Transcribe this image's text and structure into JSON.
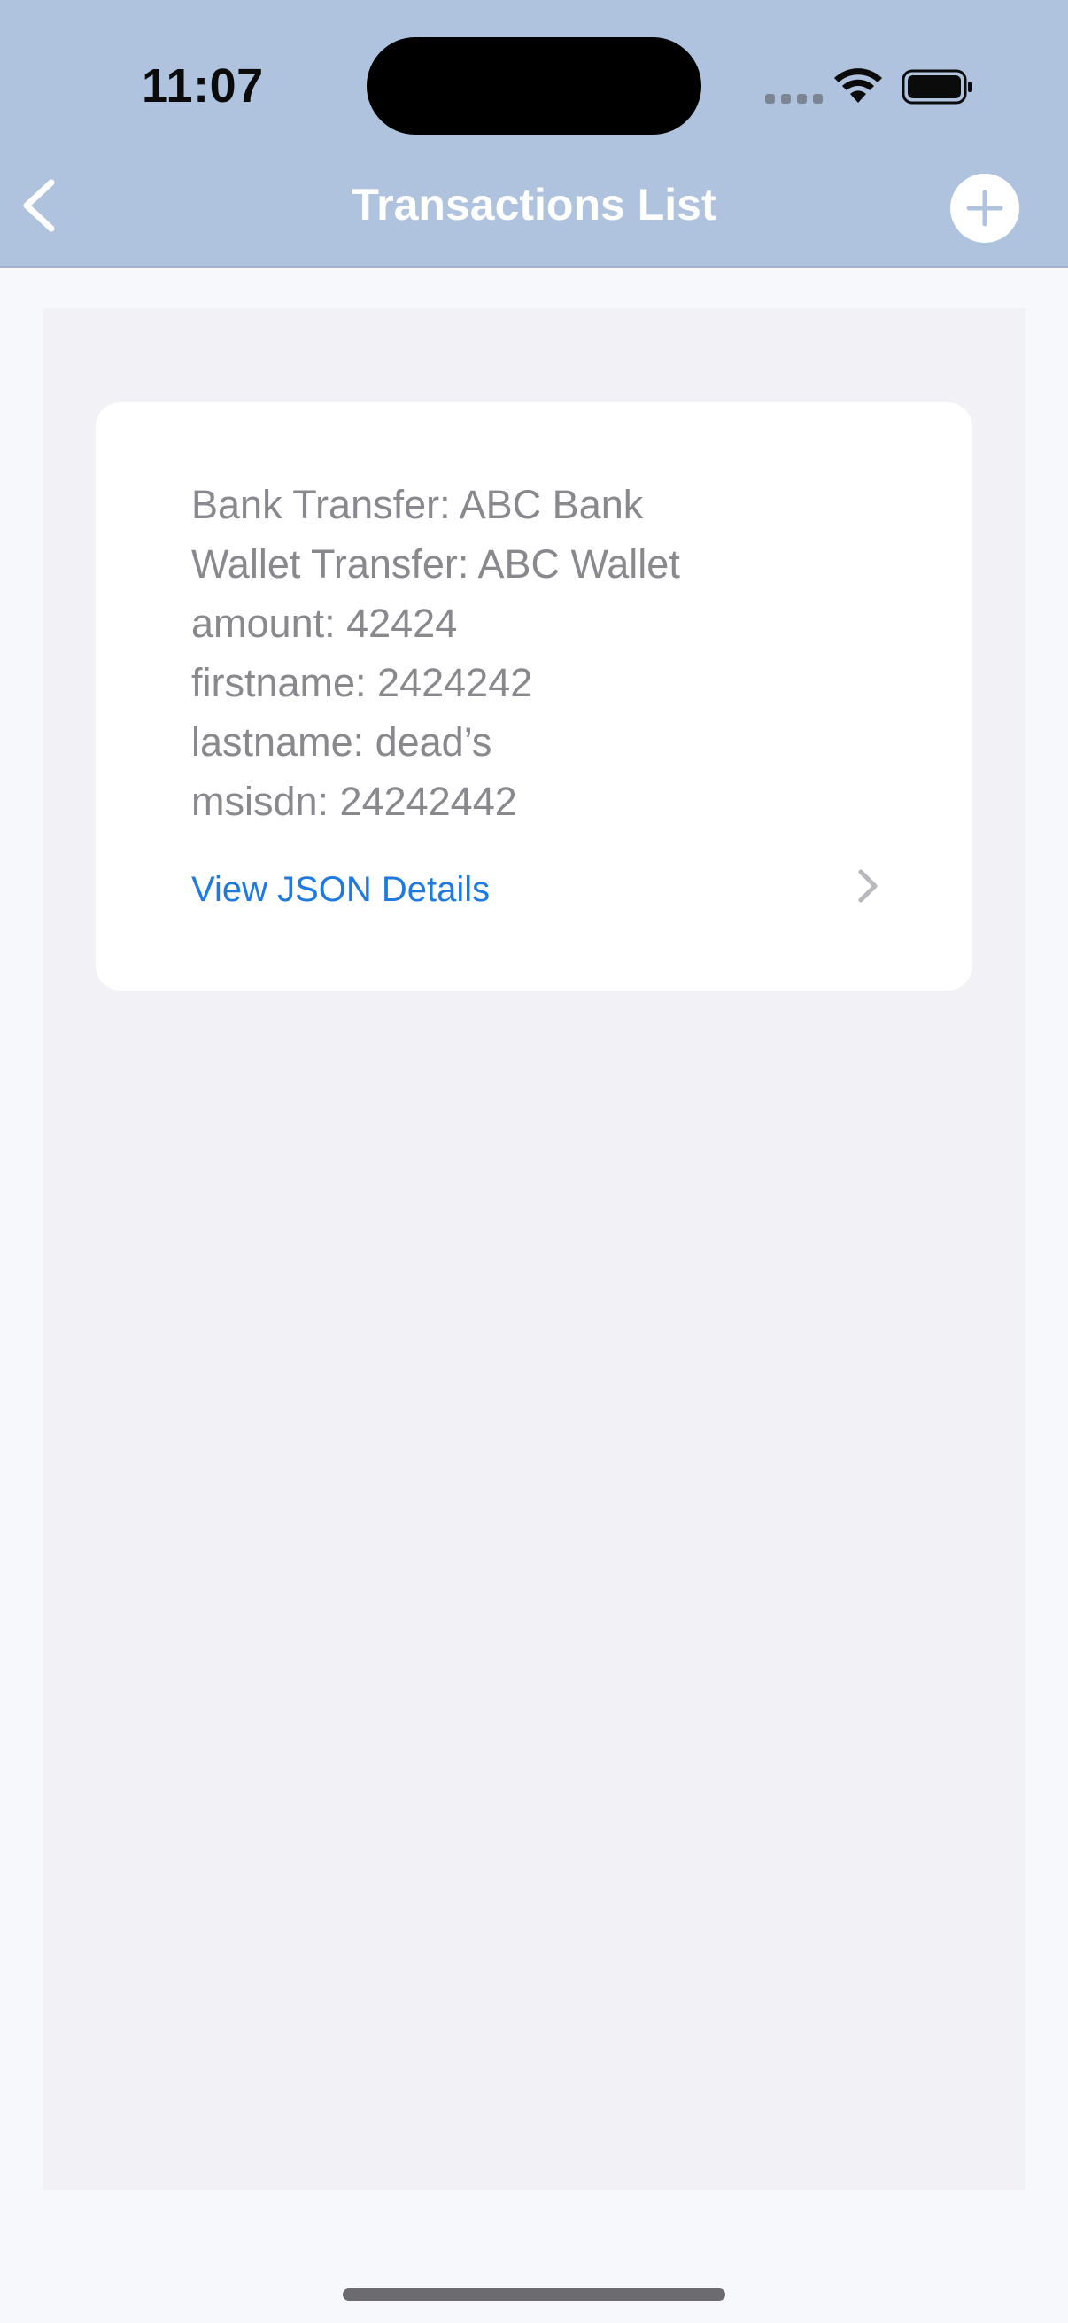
{
  "status_bar": {
    "time": "11:07"
  },
  "nav": {
    "title": "Transactions List",
    "back_icon": "chevron-left-icon",
    "add_icon": "plus-icon"
  },
  "transaction": {
    "details": [
      "Bank Transfer: ABC Bank",
      "Wallet Transfer: ABC Wallet",
      "amount: 42424",
      "firstname: 2424242",
      "lastname: dead’s",
      "msisdn: 24242442"
    ],
    "link_label": "View JSON Details"
  },
  "colors": {
    "header_bg": "#afc3df",
    "page_bg": "#f6f8fc",
    "panel_bg": "#f1f1f6",
    "link": "#1f7ae0",
    "detail_text": "#88888d"
  }
}
